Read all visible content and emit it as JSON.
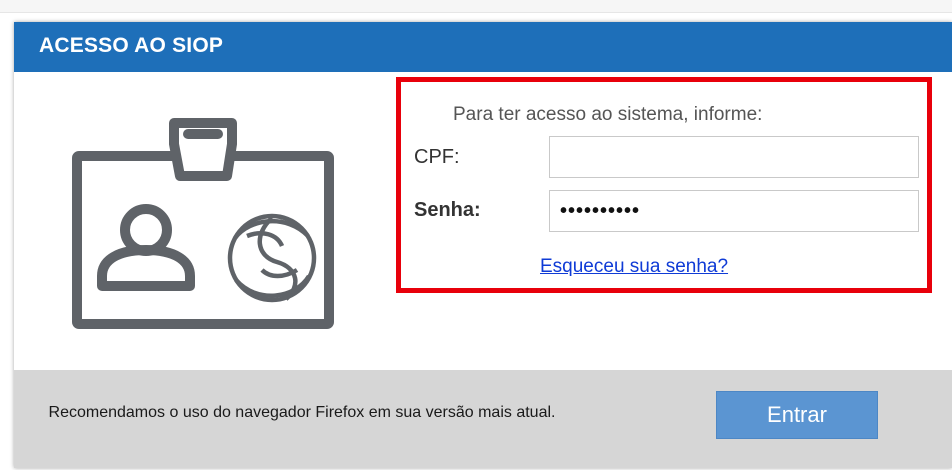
{
  "header": {
    "title": "ACESSO AO SIOP"
  },
  "illustration": {
    "icon": "id-badge-icon",
    "stroke_color": "#5f6368"
  },
  "login": {
    "prompt": "Para ter acesso ao sistema, informe:",
    "cpf_label": "CPF:",
    "cpf_value": "",
    "senha_label": "Senha:",
    "senha_value": "••••••••••",
    "forgot_link": "Esqueceu sua senha?",
    "highlight_color": "#e8000b"
  },
  "footer": {
    "note": "Recomendamos o uso do navegador Firefox em sua versão mais atual.",
    "enter_button": "Entrar"
  },
  "colors": {
    "header_bg": "#1e6fb9",
    "button_bg": "#5b95d2",
    "footer_bg": "#d6d6d6",
    "link": "#0f3bd6"
  }
}
